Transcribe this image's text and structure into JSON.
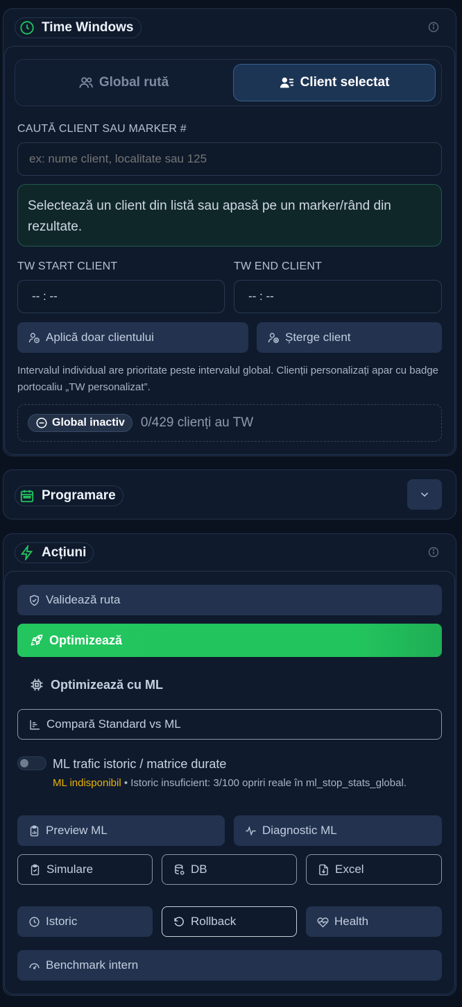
{
  "time_windows": {
    "title": "Time Windows",
    "tabs": {
      "global": "Global rută",
      "client": "Client selectat"
    },
    "search_label": "CAUTĂ CLIENT SAU MARKER #",
    "search_placeholder": "ex: nume client, localitate sau 125",
    "info_text": "Selectează un client din listă sau apasă pe un marker/rând din rezultate.",
    "tw_start_label": "TW START CLIENT",
    "tw_end_label": "TW END CLIENT",
    "tw_start_value": "-- : --",
    "tw_end_value": "-- : --",
    "apply_button": "Aplică doar clientului",
    "delete_button": "Șterge client",
    "note": "Intervalul individual are prioritate peste intervalul global. Clienții personalizați apar cu badge portocaliu „TW personalizat”.",
    "status_badge": "Global inactiv",
    "status_count": "0/429 clienți au TW"
  },
  "programare": {
    "title": "Programare"
  },
  "actiuni": {
    "title": "Acțiuni",
    "validate": "Validează ruta",
    "optimize": "Optimizează",
    "optimize_ml": "Optimizează cu ML",
    "compare": "Compară Standard vs ML",
    "ml_toggle_label": "ML trafic istoric / matrice durate",
    "ml_unavailable": "ML indisponibil",
    "ml_reason": " • Istoric insuficient: 3/100 opriri reale în ml_stop_stats_global.",
    "preview_ml": "Preview ML",
    "diagnostic_ml": "Diagnostic ML",
    "simulare": "Simulare",
    "db": "DB",
    "excel": "Excel",
    "istoric": "Istoric",
    "rollback": "Rollback",
    "health": "Health",
    "benchmark": "Benchmark intern"
  },
  "colors": {
    "accent_green": "#22c55e",
    "warning": "#eab308",
    "active_tab": "#1c3555"
  }
}
